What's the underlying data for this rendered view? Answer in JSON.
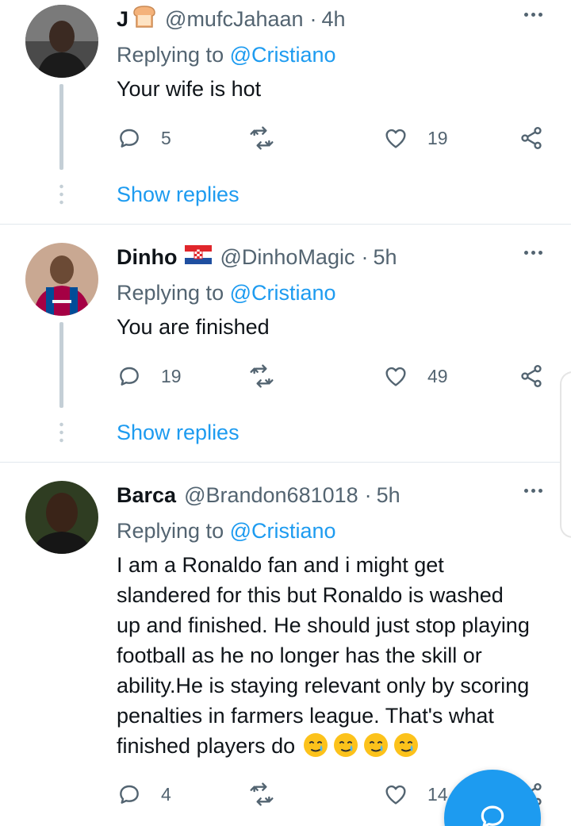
{
  "colors": {
    "accent": "#1d9bf0",
    "muted": "#536471",
    "thread_line": "#c4cfd6"
  },
  "tweets": [
    {
      "name": "J",
      "badge_icon": "bread-emoji",
      "handle": "@mufcJahaan",
      "time_sep": "·",
      "time": "4h",
      "replying_prefix": "Replying to",
      "replying_to": "@Cristiano",
      "text": "Your wife is hot",
      "replies": "5",
      "retweets": "",
      "likes": "19",
      "show_replies": "Show replies"
    },
    {
      "name": "Dinho",
      "badge_icon": "croatia-flag-emoji",
      "handle": "@DinhoMagic",
      "time_sep": "·",
      "time": "5h",
      "replying_prefix": "Replying to",
      "replying_to": "@Cristiano",
      "text": "You are finished",
      "replies": "19",
      "retweets": "",
      "likes": "49",
      "show_replies": "Show replies"
    },
    {
      "name": "Barca",
      "handle": "@Brandon681018",
      "time_sep": "·",
      "time": "5h",
      "replying_prefix": "Replying to",
      "replying_to": "@Cristiano",
      "text_lines": [
        "I am a Ronaldo fan and i might get",
        "slandered for this but Ronaldo is washed",
        "up and finished. He should just stop playing",
        "football as he no longer has the skill or",
        "ability.He is staying relevant only by scoring",
        "penalties in farmers league. That's what",
        "finished players do"
      ],
      "trailing_emoji": "crying-face-emoji",
      "replies": "4",
      "retweets": "",
      "likes": "14"
    }
  ],
  "icons": {
    "reply": "reply-icon",
    "retweet": "retweet-icon",
    "like": "heart-icon",
    "share": "share-icon",
    "compose": "compose-icon"
  }
}
